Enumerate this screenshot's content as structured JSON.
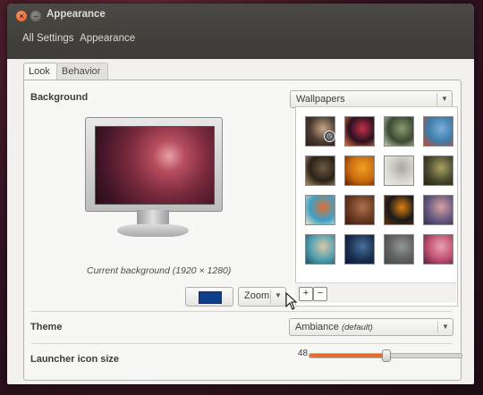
{
  "window": {
    "title": "Appearance",
    "close_glyph": "×",
    "minimize_glyph": "–"
  },
  "breadcrumbs": [
    "All Settings",
    "Appearance"
  ],
  "tabs": [
    {
      "label": "Look",
      "active": true
    },
    {
      "label": "Behavior",
      "active": false
    }
  ],
  "background": {
    "label": "Background",
    "source_combo": "Wallpapers",
    "caption": "Current background (1920 × 1280)",
    "color_swatch": "#0d3e8c",
    "placement_combo": "Zoom",
    "add_glyph": "+",
    "remove_glyph": "−",
    "wallpapers": [
      {
        "name": "wallpaper-1",
        "colors": [
          "#4a3a30",
          "#c8a888",
          "#2b1f1a"
        ],
        "selected": true
      },
      {
        "name": "wallpaper-2",
        "colors": [
          "#2a1020",
          "#c0304a",
          "#e07040"
        ]
      },
      {
        "name": "wallpaper-3",
        "colors": [
          "#3a4a30",
          "#8a9a70",
          "#c8c8b8"
        ]
      },
      {
        "name": "wallpaper-4",
        "colors": [
          "#3c7ca8",
          "#78b0d8",
          "#c84a30"
        ]
      },
      {
        "name": "wallpaper-5",
        "colors": [
          "#2a2218",
          "#6a5a40",
          "#a89068"
        ]
      },
      {
        "name": "wallpaper-6",
        "colors": [
          "#c86a10",
          "#f0a020",
          "#602000"
        ]
      },
      {
        "name": "wallpaper-7",
        "colors": [
          "#d8d8d0",
          "#a8a8a0",
          "#f0f0e8"
        ]
      },
      {
        "name": "wallpaper-8",
        "colors": [
          "#4a4a30",
          "#a8a060",
          "#202010"
        ]
      },
      {
        "name": "wallpaper-9",
        "colors": [
          "#3ca0c8",
          "#e07030",
          "#f0e0c0"
        ]
      },
      {
        "name": "wallpaper-10",
        "colors": [
          "#6a3a20",
          "#b07050",
          "#3a1a10"
        ]
      },
      {
        "name": "wallpaper-11",
        "colors": [
          "#1a1a1a",
          "#e08010",
          "#603010"
        ]
      },
      {
        "name": "wallpaper-12",
        "colors": [
          "#6a5a80",
          "#d8a0a0",
          "#2a3050"
        ]
      },
      {
        "name": "wallpaper-13",
        "colors": [
          "#50a0b0",
          "#d8c8a8",
          "#205060"
        ]
      },
      {
        "name": "wallpaper-14",
        "colors": [
          "#1a3050",
          "#4870a0",
          "#0a1830"
        ]
      },
      {
        "name": "wallpaper-15",
        "colors": [
          "#606060",
          "#909898",
          "#404848"
        ]
      },
      {
        "name": "wallpaper-16",
        "colors": [
          "#c05070",
          "#e8a0b0",
          "#502040"
        ]
      }
    ]
  },
  "theme": {
    "label": "Theme",
    "value": "Ambiance",
    "value_suffix": "(default)"
  },
  "launcher": {
    "label": "Launcher icon size",
    "value": "48",
    "slider_min": 32,
    "slider_max": 64,
    "slider_value": 48
  },
  "colors": {
    "accent": "#e86a2c",
    "titlebar": "#3c3b37"
  }
}
